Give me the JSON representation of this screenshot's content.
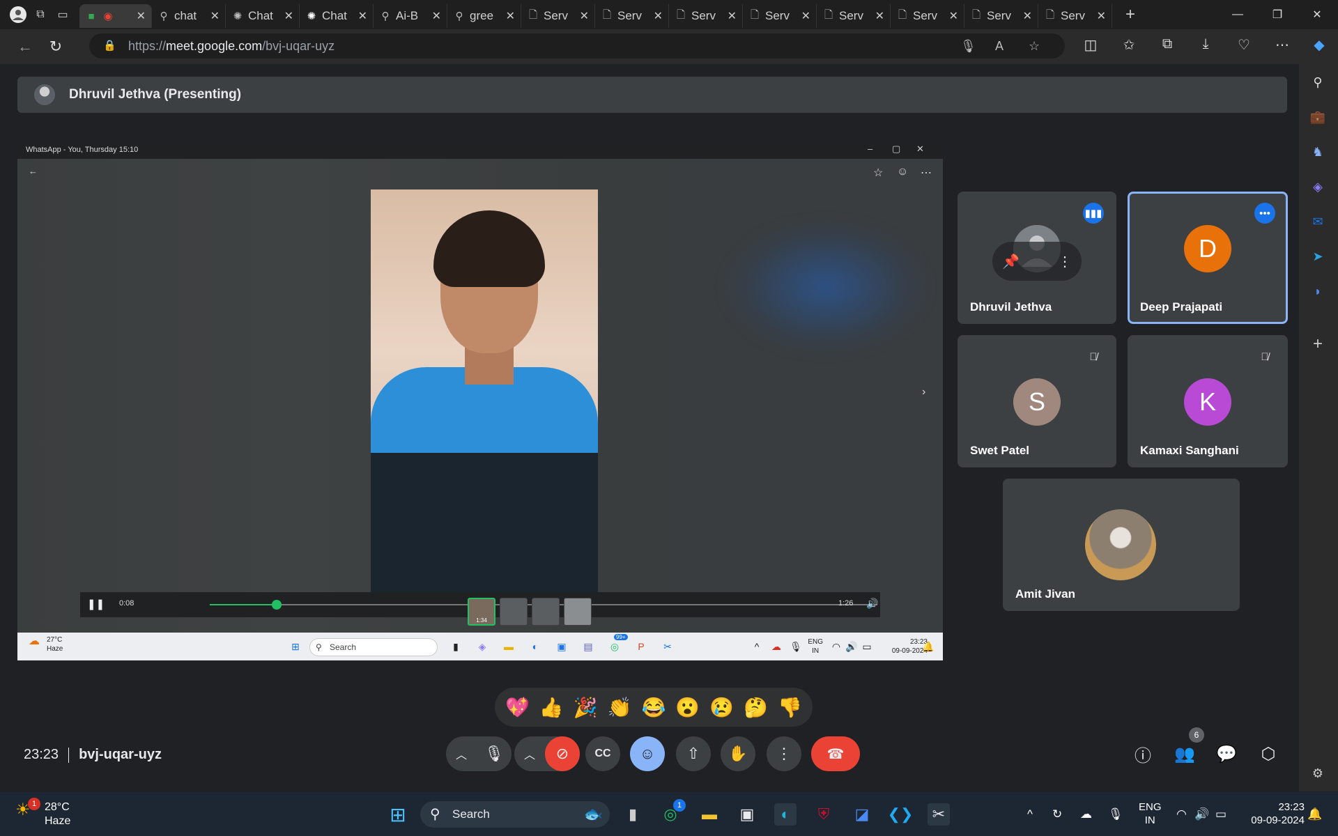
{
  "browser": {
    "tabs": [
      {
        "label": "",
        "icon": "google-meet-icon"
      },
      {
        "label": "chat",
        "icon": "search-icon"
      },
      {
        "label": "Chat",
        "icon": "openai-icon"
      },
      {
        "label": "Chat",
        "icon": "openai-icon"
      },
      {
        "label": "Ai-B",
        "icon": "search-icon"
      },
      {
        "label": "gree",
        "icon": "search-icon"
      },
      {
        "label": "Serv",
        "icon": "document-icon"
      },
      {
        "label": "Serv",
        "icon": "document-icon"
      },
      {
        "label": "Serv",
        "icon": "document-icon"
      },
      {
        "label": "Serv",
        "icon": "document-icon"
      },
      {
        "label": "Serv",
        "icon": "document-icon"
      },
      {
        "label": "Serv",
        "icon": "document-icon"
      },
      {
        "label": "Serv",
        "icon": "document-icon"
      },
      {
        "label": "Serv",
        "icon": "document-icon"
      }
    ],
    "url_prefix": "https://",
    "url_host": "meet.google.com",
    "url_path": "/bvj-uqar-uyz"
  },
  "meet": {
    "presenter_label": "Dhruvil Jethva (Presenting)",
    "meeting_time": "23:23",
    "meeting_code": "bvj-uqar-uyz",
    "people_count": "6",
    "reactions": [
      "💖",
      "👍",
      "🎉",
      "👏",
      "😂",
      "😮",
      "😢",
      "🤔",
      "👎"
    ],
    "participants": [
      {
        "name": "Dhruvil Jethva",
        "initial": "",
        "avatar_color": "#6b7075",
        "state": "speaking"
      },
      {
        "name": "Deep Prajapati",
        "initial": "D",
        "avatar_color": "#e8710a",
        "state": "more"
      },
      {
        "name": "Swet Patel",
        "initial": "S",
        "avatar_color": "#a1887f",
        "state": "muted"
      },
      {
        "name": "Kamaxi Sanghani",
        "initial": "K",
        "avatar_color": "#b94ad6",
        "state": "muted"
      },
      {
        "name": "Amit Jivan",
        "initial": "",
        "avatar_color": "#8d7f6f",
        "state": ""
      }
    ]
  },
  "shared_screen": {
    "window_title": "WhatsApp - You, Thursday 15:10",
    "video_elapsed": "0:08",
    "video_total": "1:26",
    "video_progress": 0.1,
    "thumb_duration": "1:34",
    "inner_weather_temp": "27°C",
    "inner_weather_desc": "Haze",
    "inner_search": "Search",
    "inner_lang_1": "ENG",
    "inner_lang_2": "IN",
    "inner_time": "23:23",
    "inner_date": "09-09-2024",
    "inner_badge": "99+"
  },
  "taskbar": {
    "weather_temp": "28°C",
    "weather_desc": "Haze",
    "weather_notif": "1",
    "search_label": "Search",
    "whatsapp_badge": "1",
    "lang_1": "ENG",
    "lang_2": "IN",
    "time": "23:23",
    "date": "09-09-2024"
  },
  "colors": {
    "accent_blue": "#8ab4f8",
    "end_call_red": "#ea4335",
    "whatsapp_green": "#21c063"
  }
}
